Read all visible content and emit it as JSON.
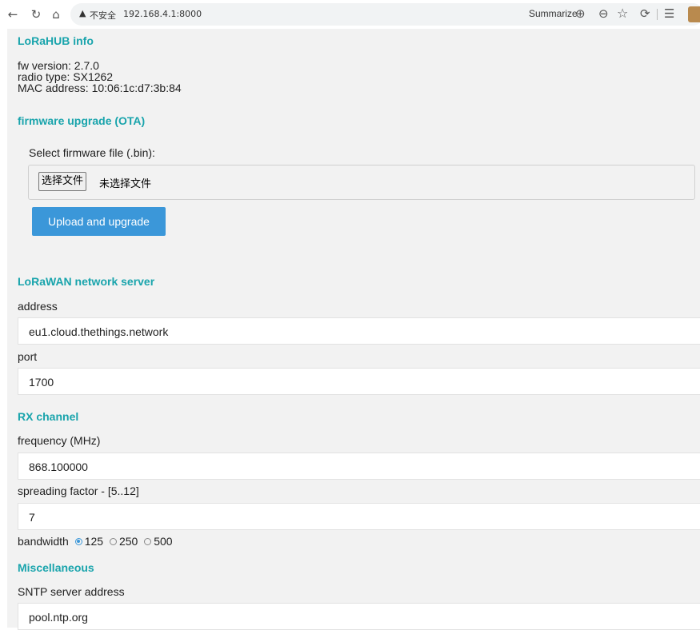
{
  "browser": {
    "insecure_label": "不安全",
    "url": "192.168.4.1:8000",
    "summarize_label": "Summarize"
  },
  "info": {
    "heading": "LoRaHUB info",
    "fw_version": "fw version: 2.7.0",
    "radio_type": "radio type: SX1262",
    "mac_address": "MAC address: 10:06:1c:d7:3b:84"
  },
  "ota": {
    "heading": "firmware upgrade (OTA)",
    "select_label": "Select firmware file (.bin):",
    "choose_file_button": "选择文件",
    "no_file_text": "未选择文件",
    "upload_button": "Upload and upgrade"
  },
  "network_server": {
    "heading": "LoRaWAN network server",
    "address_label": "address",
    "address_value": "eu1.cloud.thethings.network",
    "port_label": "port",
    "port_value": "1700"
  },
  "rx_channel": {
    "heading": "RX channel",
    "frequency_label": "frequency (MHz)",
    "frequency_value": "868.100000",
    "sf_label": "spreading factor - [5..12]",
    "sf_value": "7",
    "bandwidth_label": "bandwidth",
    "bandwidth_options": [
      "125",
      "250",
      "500"
    ],
    "bandwidth_selected": "125"
  },
  "misc": {
    "heading": "Miscellaneous",
    "sntp_label": "SNTP server address",
    "sntp_value": "pool.ntp.org"
  }
}
